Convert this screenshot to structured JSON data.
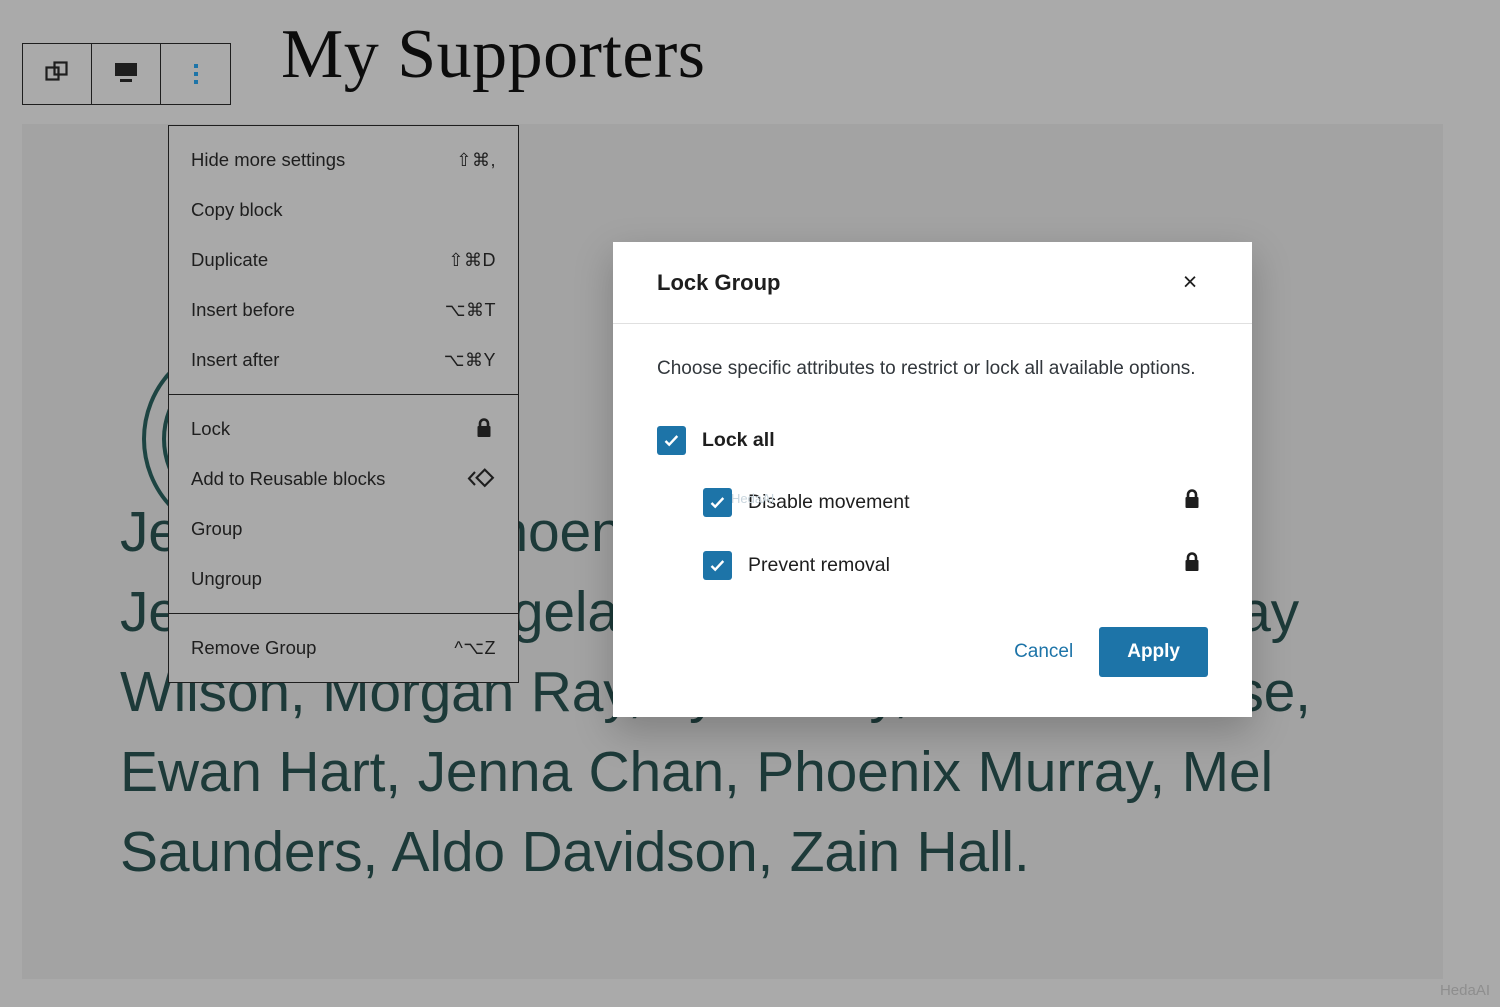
{
  "page": {
    "title": "My Supporters",
    "background_color": "#aaaaaa",
    "canvas_color": "#a3a3a3",
    "accent_color": "#1d74a8",
    "text_color": "#1d3a39",
    "body_text": "Jenna Chan, Phoenix Murray, Doug Pena, Jensen Bell, Angela Jensen, Boston Bell, Shay Wilson, Morgan Ray, Lynn Ray, Landen Reese, Ewan Hart, Jenna Chan, Phoenix Murray, Mel Saunders, Aldo Davidson, Zain Hall."
  },
  "toolbar": {
    "buttons": [
      {
        "name": "group-icon",
        "label": "Group block"
      },
      {
        "name": "block-align-icon",
        "label": "Change block alignment"
      },
      {
        "name": "more-options-icon",
        "label": "Options"
      }
    ]
  },
  "block_menu": {
    "sections": [
      {
        "items": [
          {
            "label": "Hide more settings",
            "shortcut": "⇧⌘,"
          },
          {
            "label": "Copy block",
            "shortcut": ""
          },
          {
            "label": "Duplicate",
            "shortcut": "⇧⌘D"
          },
          {
            "label": "Insert before",
            "shortcut": "⌥⌘T"
          },
          {
            "label": "Insert after",
            "shortcut": "⌥⌘Y"
          }
        ]
      },
      {
        "items": [
          {
            "label": "Lock",
            "shortcut": "",
            "icon": "lock-icon"
          },
          {
            "label": "Add to Reusable blocks",
            "shortcut": "",
            "icon": "reusable-block-icon"
          },
          {
            "label": "Group",
            "shortcut": ""
          },
          {
            "label": "Ungroup",
            "shortcut": ""
          }
        ]
      },
      {
        "items": [
          {
            "label": "Remove Group",
            "shortcut": "^⌥Z"
          }
        ]
      }
    ]
  },
  "modal": {
    "title": "Lock Group",
    "close_label": "×",
    "description": "Choose specific attributes to restrict or lock all available options.",
    "options": [
      {
        "label": "Lock all",
        "checked": true,
        "level": "master",
        "lock_icon": false
      },
      {
        "label": "Disable movement",
        "checked": true,
        "level": "sub",
        "lock_icon": true
      },
      {
        "label": "Prevent removal",
        "checked": true,
        "level": "sub",
        "lock_icon": true
      }
    ],
    "cancel_label": "Cancel",
    "apply_label": "Apply"
  },
  "watermarks": {
    "corner": "HedaAI",
    "inline": "HedaAI"
  }
}
